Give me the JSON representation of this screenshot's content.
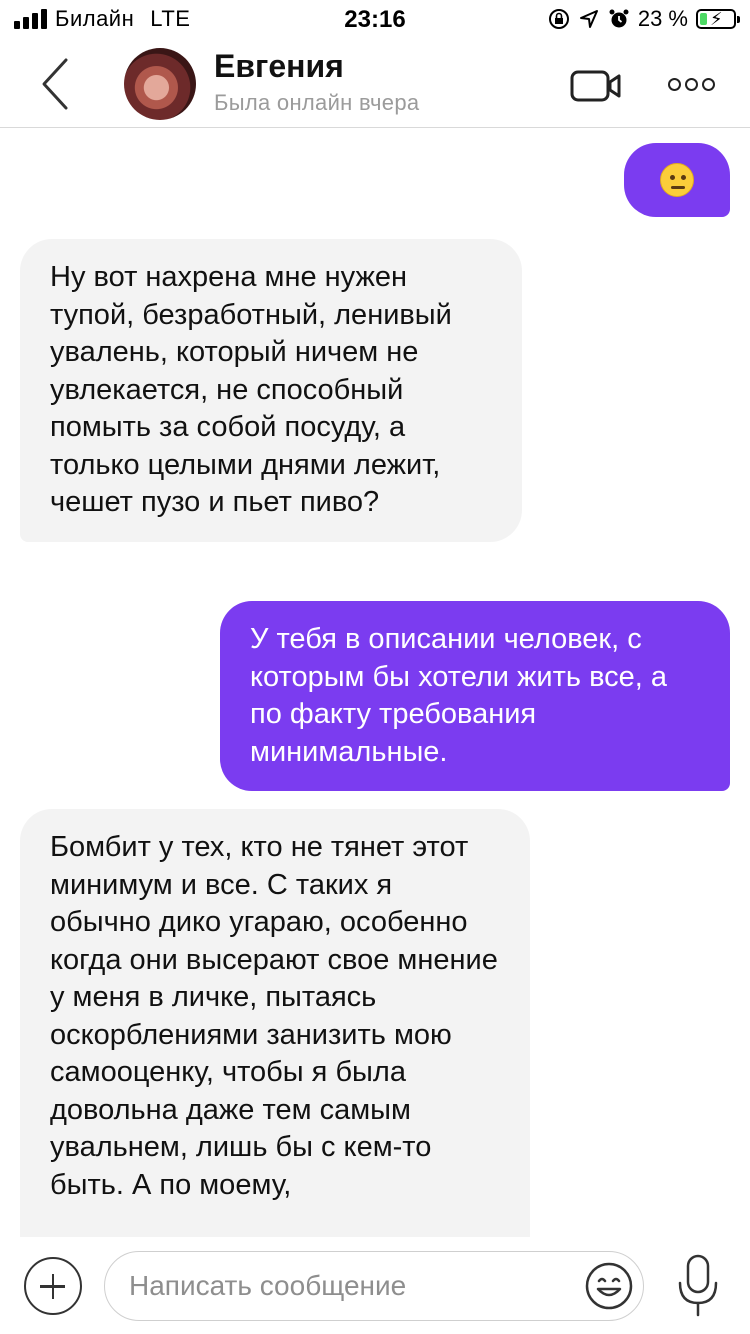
{
  "status_bar": {
    "carrier": "Билайн",
    "network": "LTE",
    "time": "23:16",
    "battery_percent": "23 %",
    "battery_level": 0.23,
    "icons": [
      "screen-lock-icon",
      "location-arrow-icon",
      "alarm-icon",
      "battery-charging-icon"
    ]
  },
  "header": {
    "contact_name": "Евгения",
    "contact_status": "Была онлайн вчера",
    "icons": [
      "back-chevron-icon",
      "video-call-icon",
      "more-dots-icon"
    ]
  },
  "messages": [
    {
      "direction": "outgoing",
      "type": "emoji",
      "emoji": "neutral-face"
    },
    {
      "direction": "incoming",
      "text": "Ну вот нахрена мне нужен тупой, безработный, ленивый увалень, который ничем не увлекается, не способный помыть за собой посуду, а только целыми днями лежит, чешет пузо и пьет пиво?"
    },
    {
      "direction": "outgoing",
      "text": "У тебя в описании человек, с которым бы хотели жить все, а по факту требования минимальные."
    },
    {
      "direction": "incoming",
      "text": "Бомбит у тех, кто не тянет этот минимум и все. С таких я обычно дико угараю, особенно когда они высерают свое мнение у меня в личке, пытаясь оскорблениями занизить мою самооценку, чтобы я была довольна даже тем самым увальнем, лишь бы с кем-то быть. А по моему,"
    }
  ],
  "input": {
    "placeholder": "Написать сообщение",
    "value": ""
  },
  "colors": {
    "outgoing_bubble": "#7b3cf0",
    "incoming_bubble": "#f3f3f3",
    "battery_fill": "#4cd964"
  }
}
